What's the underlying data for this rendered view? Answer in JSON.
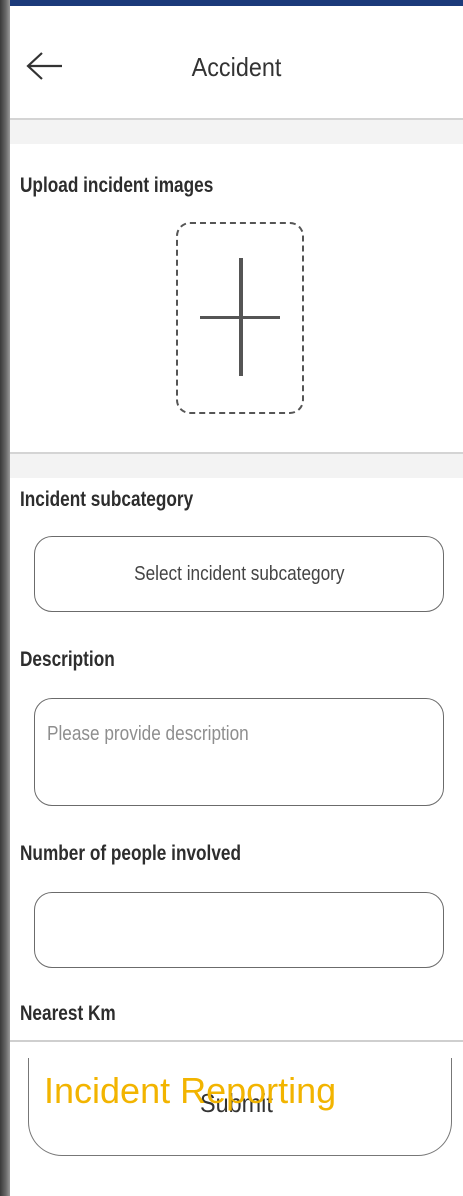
{
  "header": {
    "title": "Accident",
    "back_icon": "arrow-left-icon"
  },
  "upload": {
    "label": "Upload incident images",
    "icon": "plus-icon"
  },
  "subcategory": {
    "label": "Incident subcategory",
    "value": "Select incident subcategory"
  },
  "description": {
    "label": "Description",
    "placeholder": "Please provide description"
  },
  "people": {
    "label": "Number of people involved",
    "value": ""
  },
  "nearest_km": {
    "label": "Nearest Km"
  },
  "overlay": {
    "text": "Incident Reporting",
    "color": "#f2b400"
  },
  "submit": {
    "label": "Submit"
  }
}
